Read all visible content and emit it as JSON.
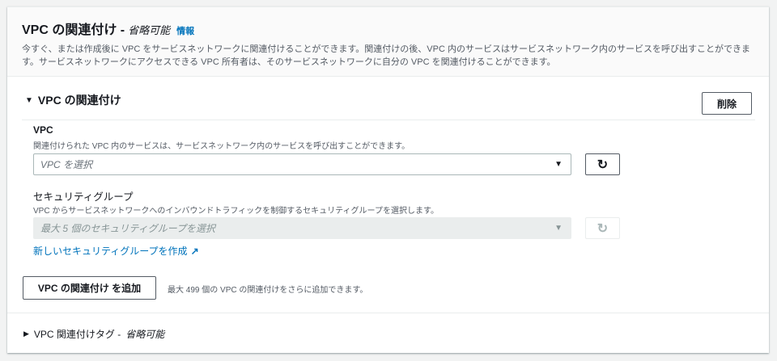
{
  "header": {
    "title": "VPC の関連付け -",
    "optional": "省略可能",
    "info": "情報",
    "description": "今すぐ、または作成後に VPC をサービスネットワークに関連付けることができます。関連付けの後、VPC 内のサービスはサービスネットワーク内のサービスを呼び出すことができます。サービスネットワークにアクセスできる VPC 所有者は、そのサービスネットワークに自分の VPC を関連付けることができます。"
  },
  "association": {
    "title": "VPC の関連付け",
    "remove_label": "削除",
    "vpc": {
      "label": "VPC",
      "hint": "関連付けられた VPC 内のサービスは、サービスネットワーク内のサービスを呼び出すことができます。",
      "placeholder": "VPC を選択"
    },
    "security_groups": {
      "label": "セキュリティグループ",
      "hint": "VPC からサービスネットワークへのインバウンドトラフィックを制御するセキュリティグループを選択します。",
      "placeholder": "最大 5 個のセキュリティグループを選択",
      "create_link": "新しいセキュリティグループを作成"
    }
  },
  "add": {
    "label": "VPC の関連付け を追加",
    "note": "最大 499 個の VPC の関連付けをさらに追加できます。"
  },
  "tags": {
    "label": "VPC 関連付けタグ -",
    "optional": "省略可能"
  }
}
